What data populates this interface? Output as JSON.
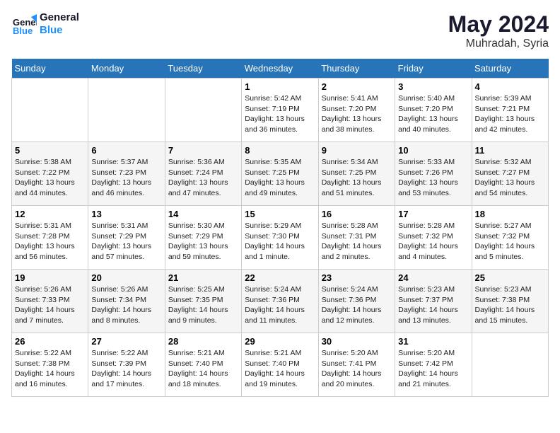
{
  "header": {
    "logo_line1": "General",
    "logo_line2": "Blue",
    "month_title": "May 2024",
    "location": "Muhradah, Syria"
  },
  "weekdays": [
    "Sunday",
    "Monday",
    "Tuesday",
    "Wednesday",
    "Thursday",
    "Friday",
    "Saturday"
  ],
  "weeks": [
    [
      {
        "day": "",
        "info": ""
      },
      {
        "day": "",
        "info": ""
      },
      {
        "day": "",
        "info": ""
      },
      {
        "day": "1",
        "info": "Sunrise: 5:42 AM\nSunset: 7:19 PM\nDaylight: 13 hours\nand 36 minutes."
      },
      {
        "day": "2",
        "info": "Sunrise: 5:41 AM\nSunset: 7:20 PM\nDaylight: 13 hours\nand 38 minutes."
      },
      {
        "day": "3",
        "info": "Sunrise: 5:40 AM\nSunset: 7:20 PM\nDaylight: 13 hours\nand 40 minutes."
      },
      {
        "day": "4",
        "info": "Sunrise: 5:39 AM\nSunset: 7:21 PM\nDaylight: 13 hours\nand 42 minutes."
      }
    ],
    [
      {
        "day": "5",
        "info": "Sunrise: 5:38 AM\nSunset: 7:22 PM\nDaylight: 13 hours\nand 44 minutes."
      },
      {
        "day": "6",
        "info": "Sunrise: 5:37 AM\nSunset: 7:23 PM\nDaylight: 13 hours\nand 46 minutes."
      },
      {
        "day": "7",
        "info": "Sunrise: 5:36 AM\nSunset: 7:24 PM\nDaylight: 13 hours\nand 47 minutes."
      },
      {
        "day": "8",
        "info": "Sunrise: 5:35 AM\nSunset: 7:25 PM\nDaylight: 13 hours\nand 49 minutes."
      },
      {
        "day": "9",
        "info": "Sunrise: 5:34 AM\nSunset: 7:25 PM\nDaylight: 13 hours\nand 51 minutes."
      },
      {
        "day": "10",
        "info": "Sunrise: 5:33 AM\nSunset: 7:26 PM\nDaylight: 13 hours\nand 53 minutes."
      },
      {
        "day": "11",
        "info": "Sunrise: 5:32 AM\nSunset: 7:27 PM\nDaylight: 13 hours\nand 54 minutes."
      }
    ],
    [
      {
        "day": "12",
        "info": "Sunrise: 5:31 AM\nSunset: 7:28 PM\nDaylight: 13 hours\nand 56 minutes."
      },
      {
        "day": "13",
        "info": "Sunrise: 5:31 AM\nSunset: 7:29 PM\nDaylight: 13 hours\nand 57 minutes."
      },
      {
        "day": "14",
        "info": "Sunrise: 5:30 AM\nSunset: 7:29 PM\nDaylight: 13 hours\nand 59 minutes."
      },
      {
        "day": "15",
        "info": "Sunrise: 5:29 AM\nSunset: 7:30 PM\nDaylight: 14 hours\nand 1 minute."
      },
      {
        "day": "16",
        "info": "Sunrise: 5:28 AM\nSunset: 7:31 PM\nDaylight: 14 hours\nand 2 minutes."
      },
      {
        "day": "17",
        "info": "Sunrise: 5:28 AM\nSunset: 7:32 PM\nDaylight: 14 hours\nand 4 minutes."
      },
      {
        "day": "18",
        "info": "Sunrise: 5:27 AM\nSunset: 7:32 PM\nDaylight: 14 hours\nand 5 minutes."
      }
    ],
    [
      {
        "day": "19",
        "info": "Sunrise: 5:26 AM\nSunset: 7:33 PM\nDaylight: 14 hours\nand 7 minutes."
      },
      {
        "day": "20",
        "info": "Sunrise: 5:26 AM\nSunset: 7:34 PM\nDaylight: 14 hours\nand 8 minutes."
      },
      {
        "day": "21",
        "info": "Sunrise: 5:25 AM\nSunset: 7:35 PM\nDaylight: 14 hours\nand 9 minutes."
      },
      {
        "day": "22",
        "info": "Sunrise: 5:24 AM\nSunset: 7:36 PM\nDaylight: 14 hours\nand 11 minutes."
      },
      {
        "day": "23",
        "info": "Sunrise: 5:24 AM\nSunset: 7:36 PM\nDaylight: 14 hours\nand 12 minutes."
      },
      {
        "day": "24",
        "info": "Sunrise: 5:23 AM\nSunset: 7:37 PM\nDaylight: 14 hours\nand 13 minutes."
      },
      {
        "day": "25",
        "info": "Sunrise: 5:23 AM\nSunset: 7:38 PM\nDaylight: 14 hours\nand 15 minutes."
      }
    ],
    [
      {
        "day": "26",
        "info": "Sunrise: 5:22 AM\nSunset: 7:38 PM\nDaylight: 14 hours\nand 16 minutes."
      },
      {
        "day": "27",
        "info": "Sunrise: 5:22 AM\nSunset: 7:39 PM\nDaylight: 14 hours\nand 17 minutes."
      },
      {
        "day": "28",
        "info": "Sunrise: 5:21 AM\nSunset: 7:40 PM\nDaylight: 14 hours\nand 18 minutes."
      },
      {
        "day": "29",
        "info": "Sunrise: 5:21 AM\nSunset: 7:40 PM\nDaylight: 14 hours\nand 19 minutes."
      },
      {
        "day": "30",
        "info": "Sunrise: 5:20 AM\nSunset: 7:41 PM\nDaylight: 14 hours\nand 20 minutes."
      },
      {
        "day": "31",
        "info": "Sunrise: 5:20 AM\nSunset: 7:42 PM\nDaylight: 14 hours\nand 21 minutes."
      },
      {
        "day": "",
        "info": ""
      }
    ]
  ]
}
